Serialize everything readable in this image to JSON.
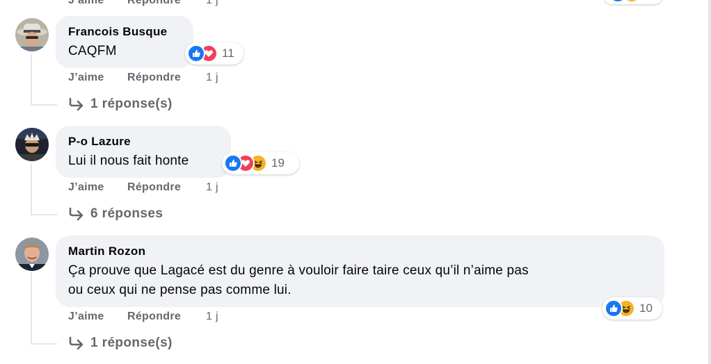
{
  "top_partial": {
    "like_label": "J’aime",
    "reply_label": "Répondre",
    "time": "1 j"
  },
  "comments": [
    {
      "author": "Francois Busque",
      "text": "CAQFM",
      "reaction_count": "11",
      "reaction_icons": [
        "like-icon",
        "love-icon"
      ],
      "like_label": "J’aime",
      "reply_label": "Répondre",
      "time": "1 j",
      "replies_label": "1 réponse(s)"
    },
    {
      "author": "P-o Lazure",
      "text": "Lui il nous fait honte",
      "reaction_count": "19",
      "reaction_icons": [
        "like-icon",
        "love-icon",
        "haha-icon"
      ],
      "like_label": "J’aime",
      "reply_label": "Répondre",
      "time": "1 j",
      "replies_label": "6 réponses"
    },
    {
      "author": "Martin Rozon",
      "text_line1": "Ça prouve que Lagacé est du genre à vouloir faire taire ceux qu’il n’aime pas",
      "text_line2": "ou ceux qui ne pense pas comme lui.",
      "reaction_count": "10",
      "reaction_icons": [
        "like-icon",
        "haha-icon"
      ],
      "like_label": "J’aime",
      "reply_label": "Répondre",
      "time": "1 j",
      "replies_label": "1 réponse(s)"
    }
  ],
  "colors": {
    "bubble": "#f0f2f5",
    "secondary_text": "#65676b",
    "like_blue": "#1877f2",
    "love_red": "#f33e58",
    "haha_yellow": "#f7b125"
  }
}
